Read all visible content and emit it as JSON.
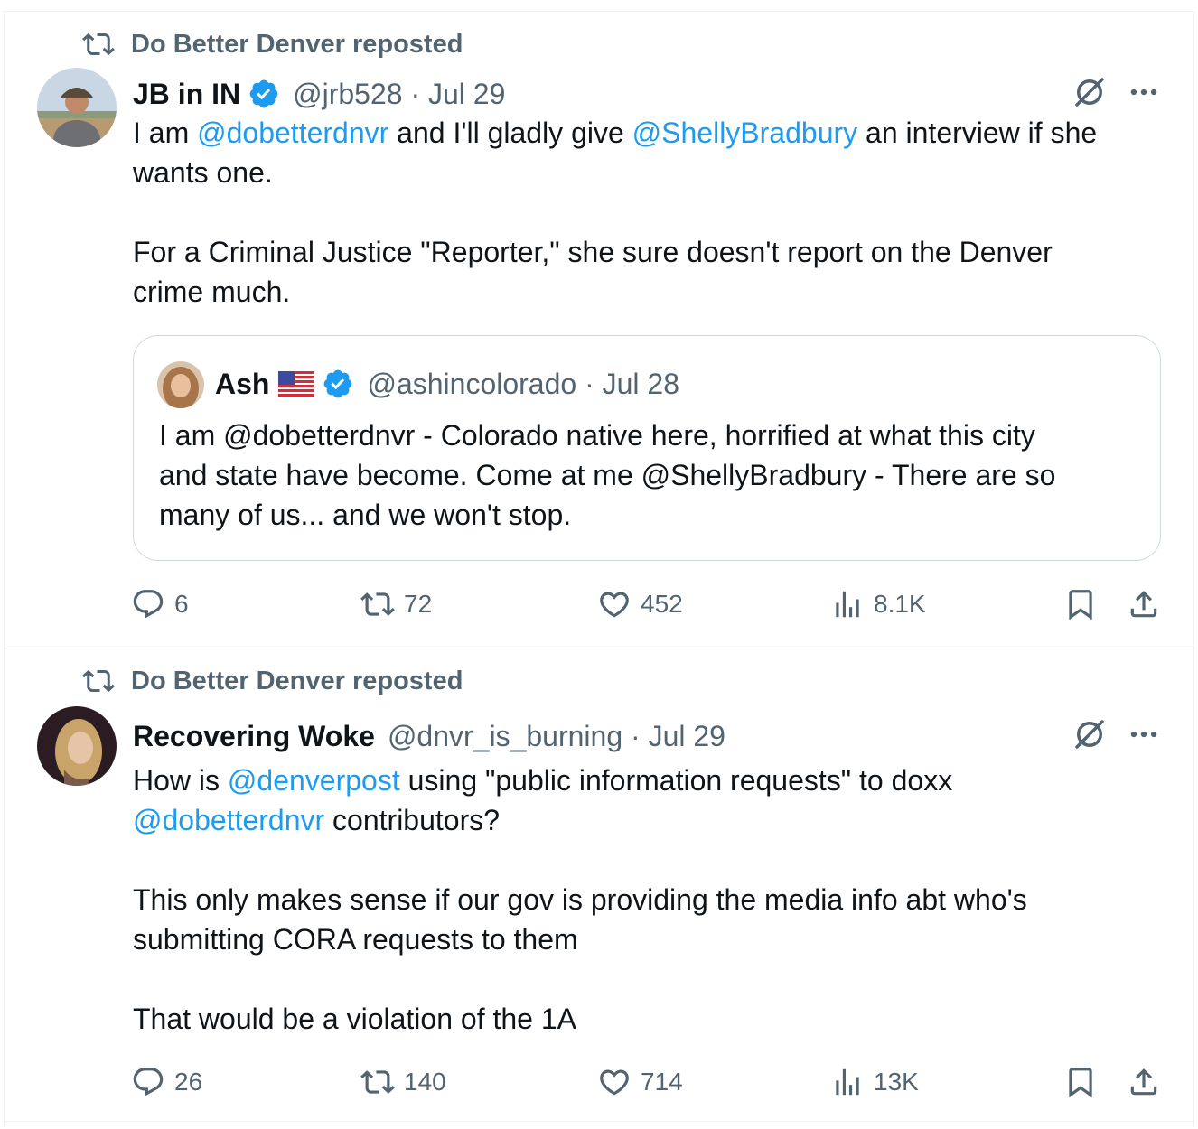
{
  "tweets": [
    {
      "repost_label": "Do Better Denver reposted",
      "author_name": "JB in IN",
      "author_handle": "@jrb528 · Jul 29",
      "body": {
        "l1_a": "I am ",
        "l1_m1": "@dobetterdnvr",
        "l1_b": " and I'll gladly give ",
        "l1_m2": "@ShellyBradbury",
        "l1_c": " an interview if she",
        "l2": "wants one.",
        "l3": "For a Criminal Justice \"Reporter,\" she sure doesn't report on the Denver",
        "l4": "crime much."
      },
      "quote": {
        "author_name": "Ash",
        "author_handle": "@ashincolorado · Jul 28",
        "text": "I am @dobetterdnvr - Colorado native here, horrified at what this city\nand state have become. Come at me @ShellyBradbury - There are so\nmany of us... and we won't stop."
      },
      "stats": {
        "replies": "6",
        "reposts": "72",
        "likes": "452",
        "views": "8.1K"
      }
    },
    {
      "repost_label": "Do Better Denver reposted",
      "author_name": "Recovering Woke",
      "author_handle": "@dnvr_is_burning · Jul 29",
      "body": {
        "l1_a": "How is ",
        "l1_m1": "@denverpost",
        "l1_b": " using \"public information requests\" to doxx",
        "l2_m": "@dobetterdnvr",
        "l2_b": " contributors?",
        "l3": "This only makes sense if our gov is providing the media info abt who's",
        "l4": "submitting CORA requests to them",
        "l5": "That would be a violation of the 1A"
      },
      "stats": {
        "replies": "26",
        "reposts": "140",
        "likes": "714",
        "views": "13K"
      }
    }
  ],
  "colors": {
    "accent": "#1d9bf0",
    "muted": "#536471",
    "text": "#0f1419",
    "border": "#cfd9de"
  },
  "icons": [
    "repost-icon",
    "verified-badge-icon",
    "grok-icon",
    "more-icon",
    "reply-icon",
    "like-icon",
    "views-icon",
    "bookmark-icon",
    "share-icon",
    "us-flag-icon"
  ]
}
